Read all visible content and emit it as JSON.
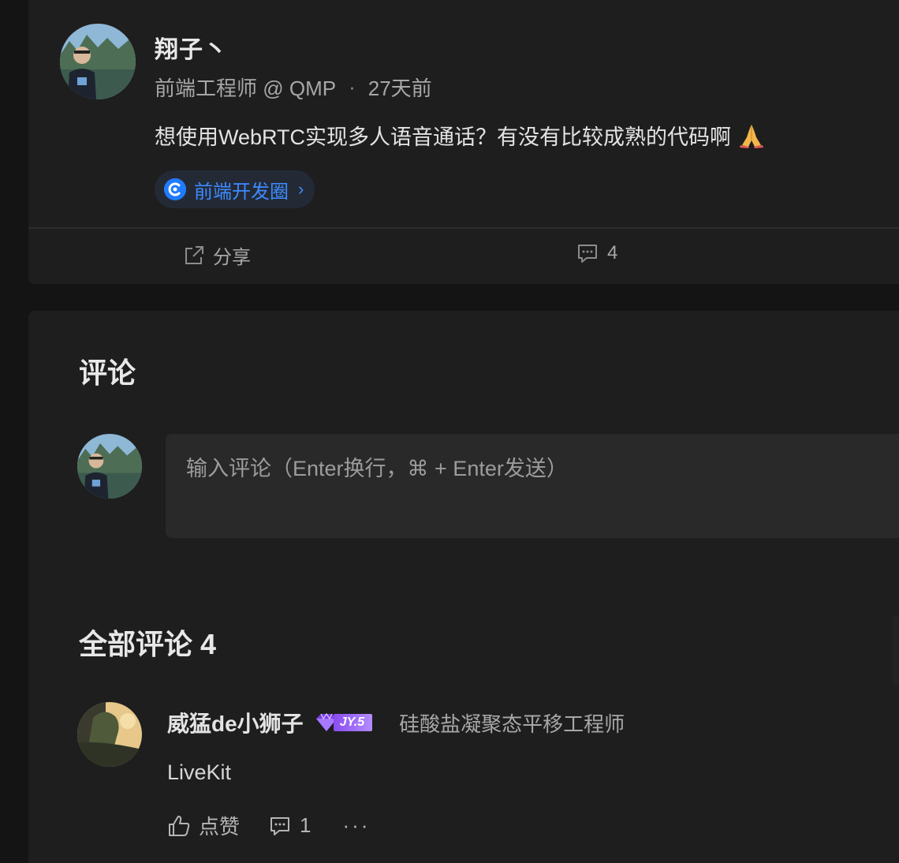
{
  "post": {
    "author": "翔子丶",
    "position": "前端工程师 @ QMP",
    "separator": "·",
    "time": "27天前",
    "content": "想使用WebRTC实现多人语音通话？有没有比较成熟的代码啊",
    "circle": "前端开发圈",
    "chevron": "›",
    "share_label": "分享",
    "comment_count": "4"
  },
  "comments_section": {
    "title": "评论",
    "input_placeholder": "输入评论（Enter换行，⌘ + Enter发送）",
    "all_title": "全部评论 4"
  },
  "comments": [
    {
      "author": "威猛de小狮子",
      "level": "JY.5",
      "title": "硅酸盐凝聚态平移工程师",
      "text": "LiveKit",
      "like_label": "点赞",
      "reply_count": "1",
      "more": "···"
    }
  ],
  "colors": {
    "accent": "#1f7bff",
    "background": "#141414",
    "card": "#1e1e1f",
    "level_badge": "#8a4cf0"
  },
  "icons": {
    "share": "share-icon",
    "comment": "comment-icon",
    "like": "thumb-up-icon",
    "circle": "circle-logo-icon",
    "emoji": "folded-hands-emoji"
  }
}
